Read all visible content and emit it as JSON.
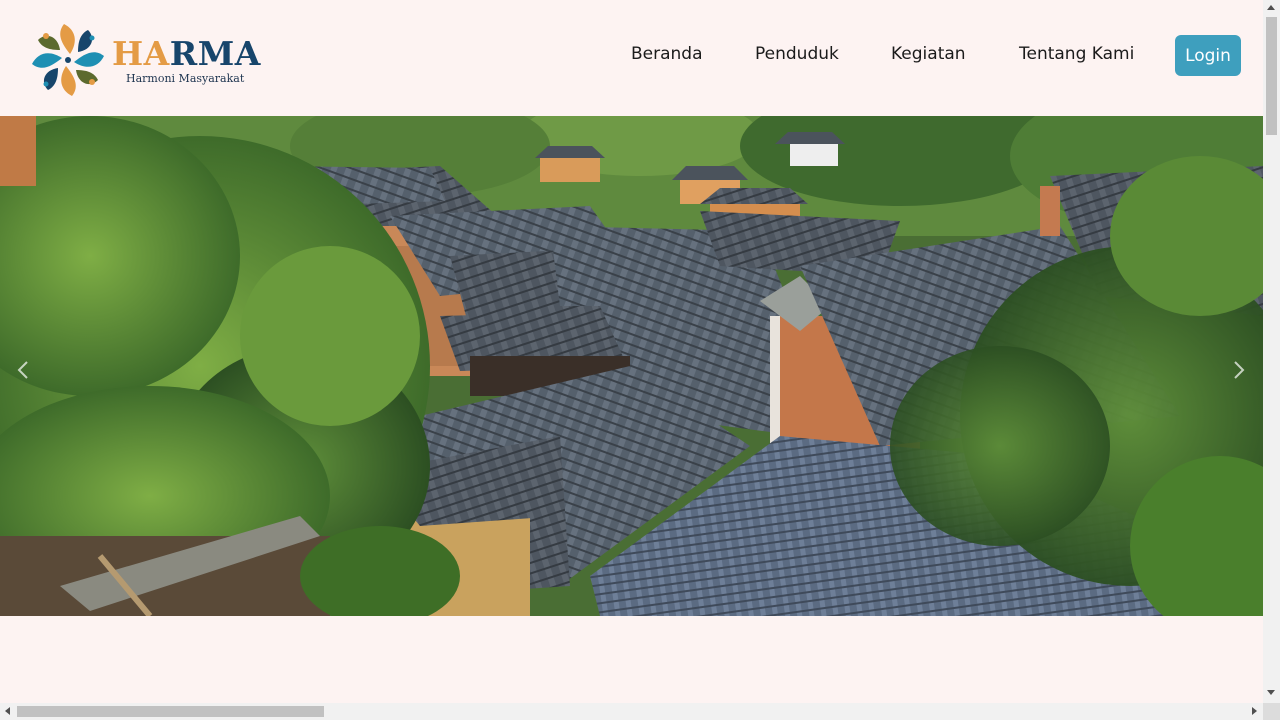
{
  "header": {
    "logo": {
      "title_part1": "HA",
      "title_part2": "RMA",
      "subtitle": "Harmoni Masyarakat"
    },
    "nav": [
      {
        "label": "Beranda"
      },
      {
        "label": "Penduduk"
      },
      {
        "label": "Kegiatan"
      },
      {
        "label": "Tentang Kami"
      }
    ],
    "login_label": "Login"
  },
  "hero": {
    "image_alt": "Atap-atap rumah tradisional di desa",
    "prev_icon": "chevron-left-icon",
    "next_icon": "chevron-right-icon"
  },
  "colors": {
    "page_background": "#fdf3f2",
    "accent": "#3e9fbe",
    "logo_orange": "#e49b45",
    "logo_navy": "#17456b"
  }
}
